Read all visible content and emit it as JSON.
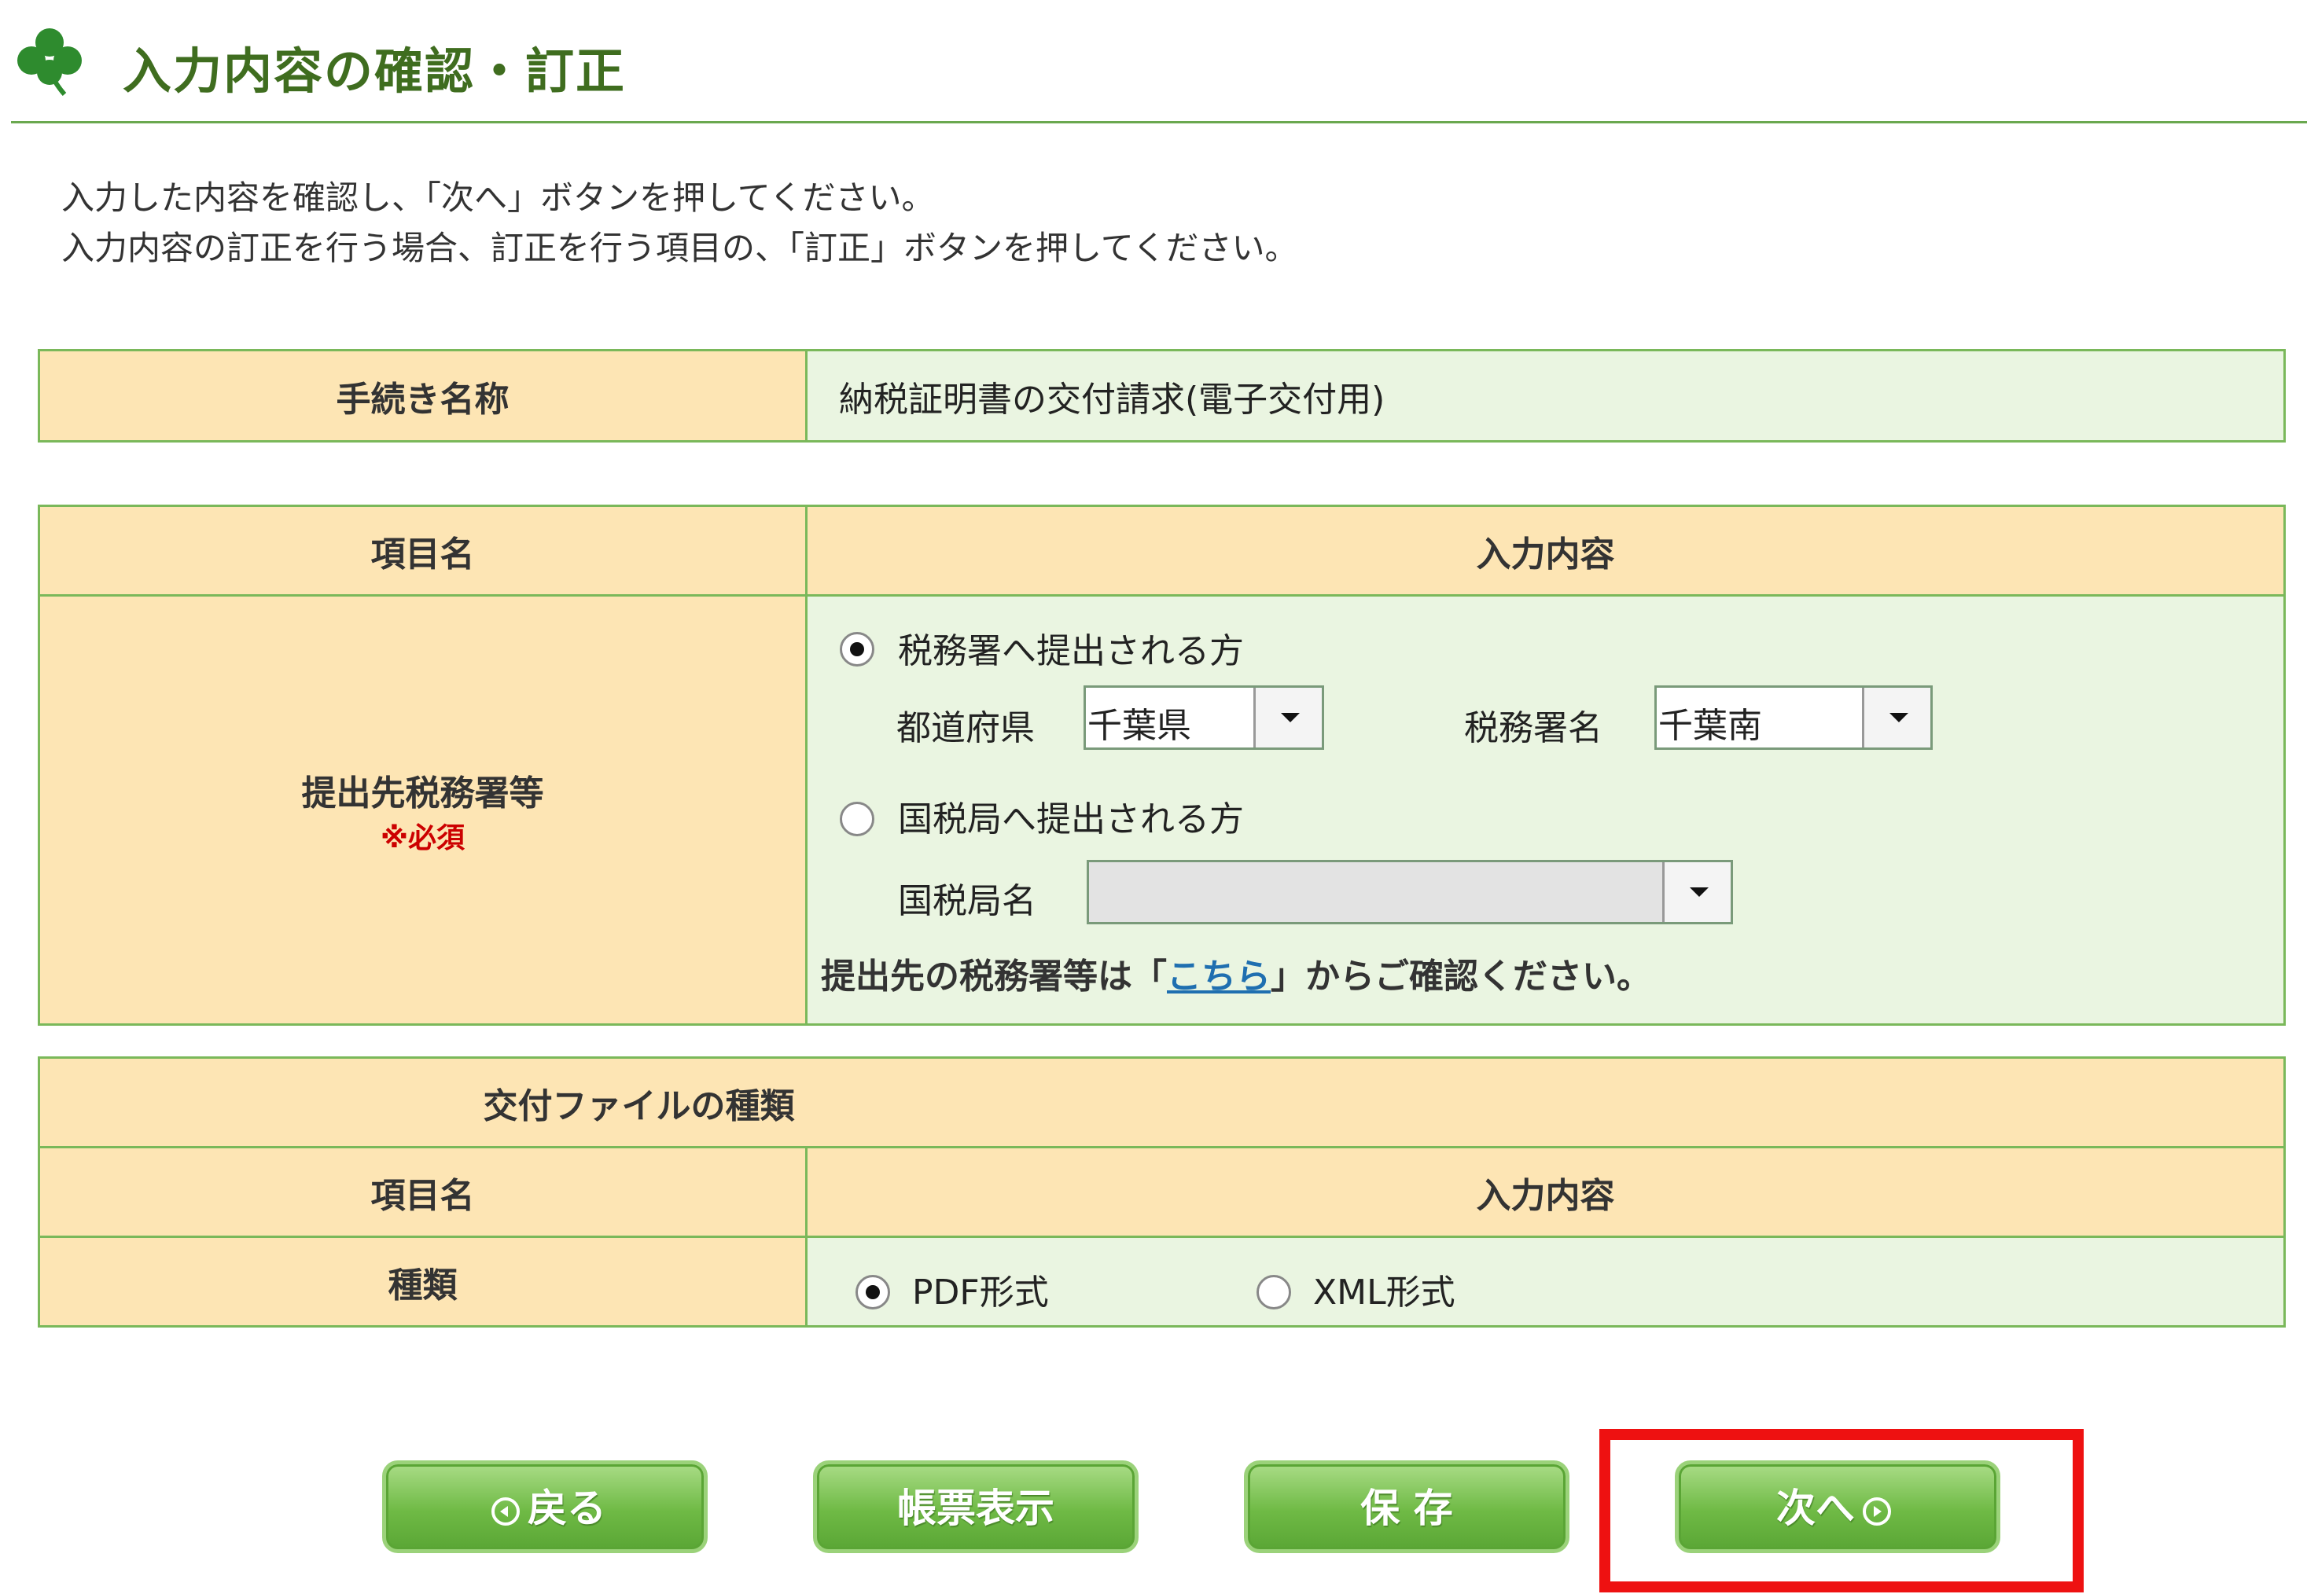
{
  "page": {
    "title": "入力内容の確認・訂正",
    "intro_line1": "入力した内容を確認し、「次へ」ボタンを押してください。",
    "intro_line2": "入力内容の訂正を行う場合、訂正を行う項目の、「訂正」ボタンを押してください。"
  },
  "procedure": {
    "label": "手続き名称",
    "value": "納税証明書の交付請求(電子交付用)"
  },
  "destination_table": {
    "col_item": "項目名",
    "col_input": "入力内容",
    "row_label": "提出先税務署等",
    "required": "※必須",
    "option_tax_office": "税務署へ提出される方",
    "prefecture_label": "都道府県",
    "prefecture_value": "千葉県",
    "office_label": "税務署名",
    "office_value": "千葉南",
    "option_regional": "国税局へ提出される方",
    "regional_label": "国税局名",
    "regional_value": "",
    "note_prefix": "提出先の税務署等は「",
    "note_link": "こちら",
    "note_suffix": "」からご確認ください。"
  },
  "file_type_table": {
    "section_title": "交付ファイルの種類",
    "col_item": "項目名",
    "col_input": "入力内容",
    "row_label": "種類",
    "option_pdf": "PDF形式",
    "option_xml": "XML形式"
  },
  "buttons": {
    "back": "戻る",
    "form_display": "帳票表示",
    "save": "保 存",
    "next": "次へ"
  },
  "colors": {
    "label_bg": "#fde5b4",
    "value_bg": "#eaf5e1",
    "border": "#7ab85a",
    "title": "#3f6d1f",
    "required": "#cc0000",
    "button": "#6fba45",
    "highlight": "#ee1111"
  }
}
